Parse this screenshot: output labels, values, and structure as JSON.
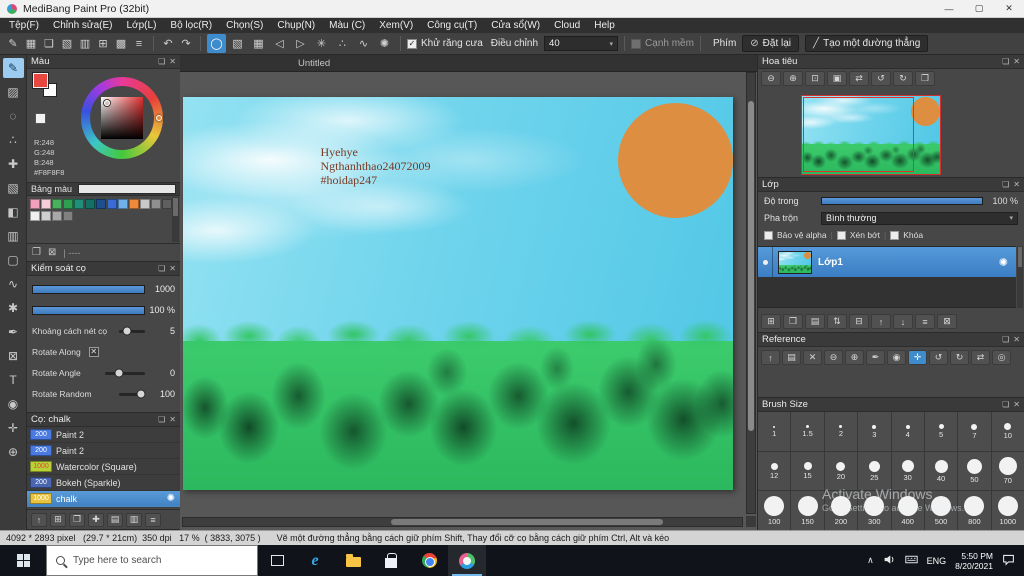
{
  "window": {
    "title": "MediBang Paint Pro (32bit)",
    "minimize_glyph": "—",
    "maximize_glyph": "▢",
    "close_glyph": "✕"
  },
  "menu": {
    "items": [
      "Tệp(F)",
      "Chỉnh sửa(E)",
      "Lớp(L)",
      "Bộ lọc(R)",
      "Chọn(S)",
      "Chụp(N)",
      "Màu (C)",
      "Xem(V)",
      "Công cụ(T)",
      "Cửa sổ(W)",
      "Cloud",
      "Help"
    ]
  },
  "icons": {
    "float": "❏",
    "close": "✕",
    "check": "✓",
    "x": "✕",
    "dropdown_arrow": "▾",
    "gear": "✺",
    "new_doc": "❐",
    "trash": "⊠"
  },
  "command_bar": {
    "file_icons": [
      {
        "name": "pen-icon",
        "glyph": "✎"
      },
      {
        "name": "save-icon",
        "glyph": "▦"
      },
      {
        "name": "comment-icon",
        "glyph": "❏"
      },
      {
        "name": "palette-icon",
        "glyph": "▧"
      },
      {
        "name": "page-icon",
        "glyph": "▥"
      },
      {
        "name": "grid-icon",
        "glyph": "⊞"
      },
      {
        "name": "material-icon",
        "glyph": "▩"
      },
      {
        "name": "panels-icon",
        "glyph": "≡"
      }
    ],
    "undo_glyph": "↶",
    "redo_glyph": "↷",
    "shape_tools": [
      {
        "name": "ellipse-tool-icon",
        "glyph": "◯",
        "selected": true
      },
      {
        "name": "gradient-tool-icon",
        "glyph": "▧"
      },
      {
        "name": "pattern-tool-icon",
        "glyph": "▦"
      },
      {
        "name": "prev-icon",
        "glyph": "◁"
      },
      {
        "name": "next-icon",
        "glyph": "▷"
      },
      {
        "name": "symmetry-tool-icon",
        "glyph": "✳"
      },
      {
        "name": "scatter-tool-icon",
        "glyph": "∴"
      },
      {
        "name": "curve-tool-icon",
        "glyph": "∿"
      },
      {
        "name": "tool-settings-icon",
        "glyph": "✺"
      }
    ],
    "antialias_label": "Khử răng cưa",
    "adjust_label": "Điều chỉnh",
    "adjust_value": "40",
    "soft_edge_label": "Cạnh mềm",
    "key_label": "Phím",
    "reset_label": "Đặt lại",
    "reset_icon": "⊘",
    "line_label": "Tạo một đường thẳng",
    "line_icon": "╱"
  },
  "tools": [
    {
      "name": "brush-tool",
      "glyph": "✎",
      "selected": true
    },
    {
      "name": "eraser-tool",
      "glyph": "▨"
    },
    {
      "name": "blur-tool",
      "glyph": "◌"
    },
    {
      "name": "smudge-tool",
      "glyph": "∴"
    },
    {
      "name": "move-tool",
      "glyph": "✚"
    },
    {
      "name": "transform-tool",
      "glyph": "▧"
    },
    {
      "name": "fill-tool",
      "glyph": "◧"
    },
    {
      "name": "gradient-tool",
      "glyph": "▥"
    },
    {
      "name": "select-tool",
      "glyph": "▢"
    },
    {
      "name": "lasso-tool",
      "glyph": "∿"
    },
    {
      "name": "magic-wand-tool",
      "glyph": "✱"
    },
    {
      "name": "select-pen-tool",
      "glyph": "✒"
    },
    {
      "name": "select-eraser-tool",
      "glyph": "⊠"
    },
    {
      "name": "text-tool",
      "glyph": "T"
    },
    {
      "name": "eyedropper-tool",
      "glyph": "◉"
    },
    {
      "name": "hand-tool",
      "glyph": "✛"
    },
    {
      "name": "zoom-tool",
      "glyph": "⊕"
    }
  ],
  "color_panel": {
    "title": "Màu",
    "foreground": "#e8473f",
    "background": "#ffffff",
    "rgb_lines": [
      "R:248",
      "G:248",
      "B:248",
      "#F8F8F8"
    ],
    "palette_label": "Bảng màu",
    "palette_row1": [
      "#f2a0bc",
      "#f7cdd9",
      "#49b05e",
      "#2e9e53",
      "#1f8f7a",
      "#147064",
      "#1c4f8c",
      "#3a6cd4",
      "#6fb1e8",
      "#ef8a3a",
      "#c9c9c9",
      "#8f8f8f",
      "#5f5f5f"
    ],
    "palette_row2": [
      "#f0f0f0",
      "#cfcfcf",
      "#a8a8a8",
      "#808080"
    ],
    "dashes": "|  ----"
  },
  "brush_control": {
    "title": "Kiểm soát cọ",
    "size_value": "1000",
    "opacity_value": "100 %",
    "spacing_label": "Khoảng cách nét cọ",
    "spacing_value": "5",
    "rotate_along_label": "Rotate Along",
    "rotate_angle_label": "Rotate Angle",
    "rotate_angle_value": "0",
    "rotate_random_label": "Rotate Random",
    "rotate_random_value": "100"
  },
  "brush_panel": {
    "title": "Cọ: chalk",
    "brushes": [
      {
        "size": "200",
        "name": "Paint 2",
        "chip": "#4a7ae0"
      },
      {
        "size": "200",
        "name": "Paint 2",
        "chip": "#4a7ae0"
      },
      {
        "size": "1000",
        "name": "Watercolor (Square)",
        "chip": "#b7d235",
        "size_color": "#e04840"
      },
      {
        "size": "200",
        "name": "Bokeh (Sparkle)",
        "chip": "#4a66b0"
      },
      {
        "size": "1000",
        "name": "chalk",
        "chip": "#e8c23c",
        "selected": true
      }
    ],
    "action_icons": [
      {
        "name": "brush-up-icon",
        "glyph": "↑"
      },
      {
        "name": "add-brush-icon",
        "glyph": "⊞"
      },
      {
        "name": "duplicate-brush-icon",
        "glyph": "❐"
      },
      {
        "name": "edit-brush-icon",
        "glyph": "✚"
      },
      {
        "name": "brush-folder-icon",
        "glyph": "▤"
      },
      {
        "name": "import-brush-icon",
        "glyph": "▥"
      },
      {
        "name": "brush-menu-icon",
        "glyph": "≡"
      }
    ]
  },
  "canvas": {
    "tab_title": "Untitled",
    "text_lines": [
      "Hyehye",
      "Ngthanhthao24072009",
      "#hoidap247"
    ]
  },
  "navigator": {
    "title": "Hoa tiêu",
    "icons": [
      {
        "name": "zoom-out-icon",
        "glyph": "⊖"
      },
      {
        "name": "zoom-in-icon",
        "glyph": "⊕"
      },
      {
        "name": "fit-view-icon",
        "glyph": "⊡"
      },
      {
        "name": "actual-size-icon",
        "glyph": "▣"
      },
      {
        "name": "flip-horizontal-icon",
        "glyph": "⇄"
      },
      {
        "name": "rotate-left-icon",
        "glyph": "↺"
      },
      {
        "name": "rotate-right-icon",
        "glyph": "↻"
      },
      {
        "name": "snapshot-icon",
        "glyph": "❐"
      }
    ]
  },
  "layers_panel": {
    "title": "Lớp",
    "opacity_label": "Độ trong",
    "opacity_value": "100 %",
    "blend_label": "Pha trộn",
    "blend_value": "Bình thường",
    "alpha_label": "Bảo vệ alpha",
    "clip_label": "Xén bớt",
    "lock_label": "Khóa",
    "layers": [
      {
        "name": "Lớp1",
        "selected": true
      }
    ],
    "action_icons": [
      {
        "name": "new-layer-icon",
        "glyph": "⊞"
      },
      {
        "name": "duplicate-layer-icon",
        "glyph": "❐"
      },
      {
        "name": "add-folder-icon",
        "glyph": "▤"
      },
      {
        "name": "transfer-layer-icon",
        "glyph": "⇅"
      },
      {
        "name": "merge-layer-icon",
        "glyph": "⊟"
      },
      {
        "name": "layer-up-icon",
        "glyph": "↑"
      },
      {
        "name": "layer-down-icon",
        "glyph": "↓"
      },
      {
        "name": "layer-menu-icon",
        "glyph": "≡"
      },
      {
        "name": "delete-layer-icon",
        "glyph": "⊠"
      }
    ]
  },
  "reference_panel": {
    "title": "Reference",
    "icons": [
      {
        "name": "open-up-icon",
        "glyph": "↑"
      },
      {
        "name": "ref-folder-icon",
        "glyph": "▤"
      },
      {
        "name": "ref-close-icon",
        "glyph": "✕"
      },
      {
        "name": "ref-zoom-out-icon",
        "glyph": "⊖"
      },
      {
        "name": "ref-zoom-in-icon",
        "glyph": "⊕"
      },
      {
        "name": "ref-pen-icon",
        "glyph": "✒"
      },
      {
        "name": "ref-eyedropper-icon",
        "glyph": "◉"
      },
      {
        "name": "ref-hand-icon",
        "glyph": "✛",
        "selected": true
      },
      {
        "name": "ref-rotate-left-icon",
        "glyph": "↺"
      },
      {
        "name": "ref-rotate-right-icon",
        "glyph": "↻"
      },
      {
        "name": "ref-flip-icon",
        "glyph": "⇄"
      },
      {
        "name": "ref-reset-icon",
        "glyph": "◎"
      }
    ]
  },
  "brush_size_panel": {
    "title": "Brush Size",
    "sizes": [
      "1",
      "1.5",
      "2",
      "3",
      "4",
      "5",
      "7",
      "10",
      "12",
      "15",
      "20",
      "25",
      "30",
      "40",
      "50",
      "70",
      "100",
      "150",
      "200",
      "300",
      "400",
      "500",
      "800",
      "1000"
    ]
  },
  "status_bar": {
    "info": "4092 * 2893 pixel   (29.7 * 21cm)  350 dpi   17 %  ( 3833, 3075 )",
    "hint": "Vẽ một đường thẳng bằng cách giữ phím Shift, Thay đổi cỡ cọ bằng cách giữ phím Ctrl, Alt và kéo"
  },
  "taskbar": {
    "search_placeholder": "Type here to search",
    "apps": [
      {
        "name": "task-view-icon",
        "cls": "ico-taskview"
      },
      {
        "name": "edge-icon",
        "cls": "ico-edge"
      },
      {
        "name": "file-explorer-icon",
        "cls": "ico-folder"
      },
      {
        "name": "store-icon",
        "cls": "ico-store"
      },
      {
        "name": "chrome-icon",
        "cls": "ico-chrome"
      },
      {
        "name": "medibang-icon",
        "cls": "ico-medibang",
        "selected": true
      }
    ],
    "lang": "ENG",
    "time": "5:50 PM",
    "date": "8/20/2021"
  },
  "watermark": {
    "line1": "Activate Windows",
    "line2": "Go to Settings to activate Windows."
  }
}
